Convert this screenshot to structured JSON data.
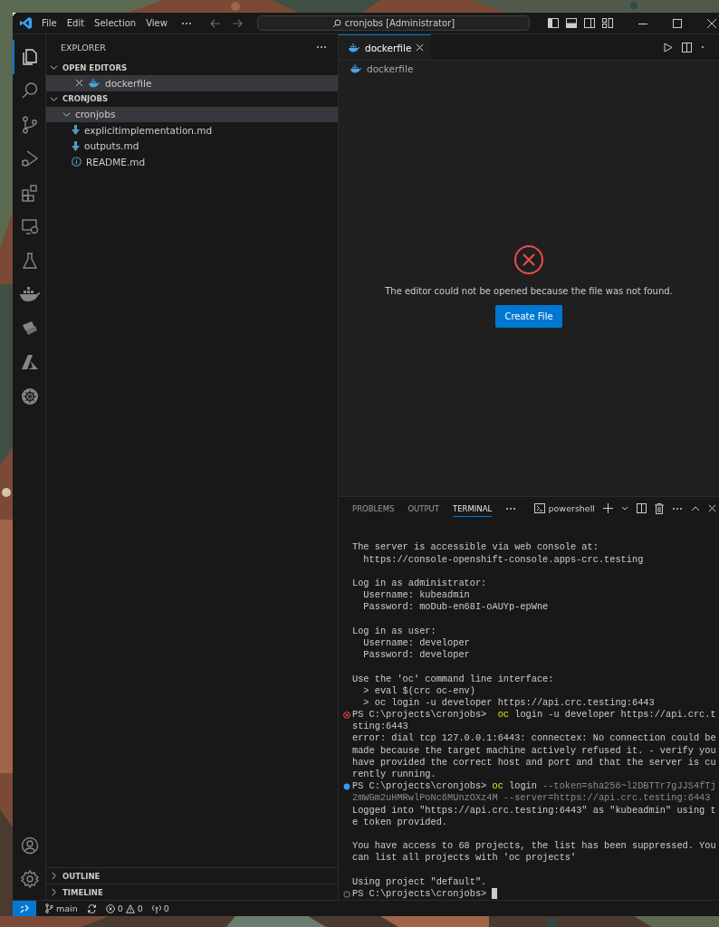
{
  "title_bar": {
    "menu": [
      "File",
      "Edit",
      "Selection",
      "View"
    ],
    "command_center": "cronjobs [Administrator]"
  },
  "activity_bar": {
    "top": [
      {
        "kind": "files",
        "selected": true
      },
      {
        "kind": "search",
        "selected": false
      },
      {
        "kind": "source-control",
        "selected": false
      },
      {
        "kind": "run-debug",
        "selected": false
      },
      {
        "kind": "extensions",
        "selected": false
      },
      {
        "kind": "remote",
        "selected": false
      },
      {
        "kind": "testing",
        "selected": false
      },
      {
        "kind": "docker",
        "selected": false
      },
      {
        "kind": "openshift",
        "selected": false
      },
      {
        "kind": "azure",
        "selected": false
      },
      {
        "kind": "kubernetes",
        "selected": false
      }
    ],
    "bottom": [
      {
        "kind": "account",
        "selected": false
      },
      {
        "kind": "gear",
        "selected": false
      }
    ]
  },
  "sidebar": {
    "title": "EXPLORER",
    "sections": [
      {
        "kind": "open-editors",
        "title": "OPEN EDITORS",
        "expanded": true,
        "items": [
          {
            "name": "dockerfile",
            "kind": "docker",
            "selected": true
          }
        ]
      },
      {
        "kind": "folder",
        "title": "CRONJOBS",
        "expanded": true,
        "items": [
          {
            "name": "cronjobs",
            "kind": "folder",
            "selected": true,
            "expanded": true,
            "children": [
              {
                "name": "explicitimplementation.md",
                "kind": "download",
                "selected": false
              },
              {
                "name": "outputs.md",
                "kind": "download",
                "selected": false
              },
              {
                "name": "README.md",
                "kind": "info",
                "selected": false
              }
            ]
          }
        ]
      }
    ],
    "bottom_sections": [
      {
        "title": "OUTLINE",
        "expanded": false
      },
      {
        "title": "TIMELINE",
        "expanded": false
      }
    ]
  },
  "editor": {
    "tabs": [
      {
        "label": "dockerfile",
        "selected": true
      }
    ],
    "breadcrumb": "dockerfile",
    "message": "The editor could not be opened because the file was not found.",
    "button": "Create File"
  },
  "panel": {
    "tabs": [
      {
        "label": "PROBLEMS",
        "selected": false
      },
      {
        "label": "OUTPUT",
        "selected": false
      },
      {
        "label": "TERMINAL",
        "selected": true
      }
    ],
    "terminal_name": "powershell",
    "terminal_lines": [
      {
        "kind": "blank"
      },
      {
        "kind": "output",
        "text": "The server is accessible via web console at:"
      },
      {
        "kind": "output",
        "text": "  https://console-openshift-console.apps-crc.testing"
      },
      {
        "kind": "blank"
      },
      {
        "kind": "output",
        "text": "Log in as administrator:"
      },
      {
        "kind": "output",
        "text": "  Username: kubeadmin"
      },
      {
        "kind": "output",
        "text": "  Password: moDub-en68I-oAUYp-epWne"
      },
      {
        "kind": "blank"
      },
      {
        "kind": "output",
        "text": "Log in as user:"
      },
      {
        "kind": "output",
        "text": "  Username: developer"
      },
      {
        "kind": "output",
        "text": "  Password: developer"
      },
      {
        "kind": "blank"
      },
      {
        "kind": "output",
        "text": "Use the 'oc' command line interface:"
      },
      {
        "kind": "output",
        "text": "  > eval $(crc oc-env)"
      },
      {
        "kind": "output",
        "text": "  > oc login -u developer https://api.crc.testing:6443"
      },
      {
        "kind": "failed",
        "segments": [
          {
            "kind": "plain",
            "text": "PS C:\\projects\\cronjobs>  "
          },
          {
            "kind": "command",
            "text": "oc"
          },
          {
            "kind": "plain",
            "text": " login -u developer https://api.crc.t"
          }
        ]
      },
      {
        "kind": "output",
        "text": "sting:6443"
      },
      {
        "kind": "output",
        "text": "error: dial tcp 127.0.0.1:6443: connectex: No connection could be"
      },
      {
        "kind": "output",
        "text": "made because the target machine actively refused it. - verify you"
      },
      {
        "kind": "output",
        "text": "have provided the correct host and port and that the server is cu"
      },
      {
        "kind": "output",
        "text": "rently running."
      },
      {
        "kind": "succeeded",
        "segments": [
          {
            "kind": "plain",
            "text": "PS C:\\projects\\cronjobs> "
          },
          {
            "kind": "command",
            "text": "oc"
          },
          {
            "kind": "plain",
            "text": " login "
          },
          {
            "kind": "flag",
            "text": "--token=sha256~l2DBTTr7gJJS4fTj"
          }
        ]
      },
      {
        "kind": "wrapped",
        "segments": [
          {
            "kind": "flag",
            "text": "2mWGm2uHMRwlPoNc6MUnzOXz4M --server=https://api.crc.testing:6443"
          }
        ]
      },
      {
        "kind": "output",
        "text": "Logged into \"https://api.crc.testing:6443\" as \"kubeadmin\" using t"
      },
      {
        "kind": "output",
        "text": "e token provided."
      },
      {
        "kind": "blank"
      },
      {
        "kind": "output",
        "text": "You have access to 68 projects, the list has been suppressed. You"
      },
      {
        "kind": "output",
        "text": "can list all projects with 'oc projects'"
      },
      {
        "kind": "blank"
      },
      {
        "kind": "output",
        "text": "Using project \"default\"."
      },
      {
        "kind": "pending",
        "cursor": true,
        "segments": [
          {
            "kind": "plain",
            "text": "PS C:\\projects\\cronjobs> "
          }
        ]
      }
    ]
  },
  "status_bar": {
    "branch": "main",
    "errors": "0",
    "warnings": "0",
    "ports": "0"
  }
}
